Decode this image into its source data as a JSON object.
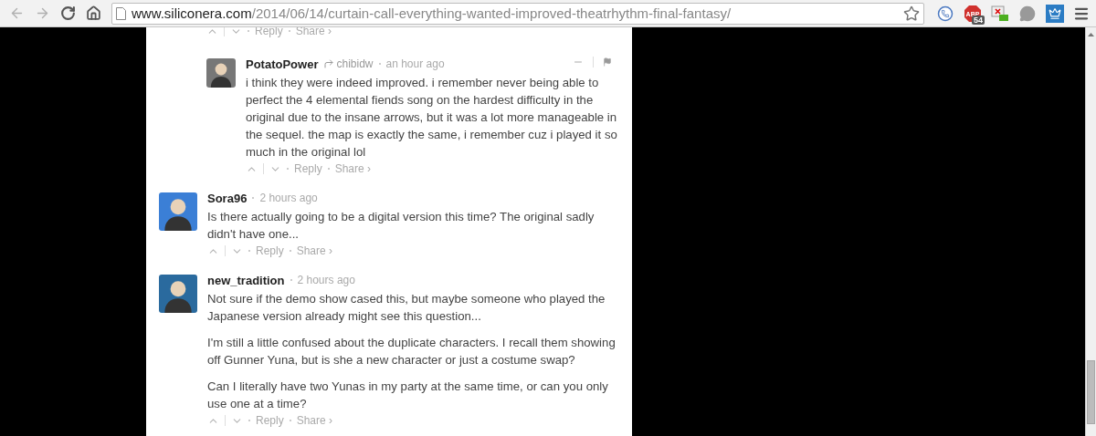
{
  "browser": {
    "url_host": "www.siliconera.com",
    "url_path": "/2014/06/14/curtain-call-everything-wanted-improved-theatrhythm-final-fantasy/",
    "extensions": [
      {
        "kind": "phone"
      },
      {
        "kind": "adblock",
        "label": "ABP",
        "badge": "54"
      },
      {
        "kind": "screen"
      },
      {
        "kind": "bubble"
      },
      {
        "kind": "crown"
      }
    ]
  },
  "previous_actions": {
    "reply": "Reply",
    "share": "Share ›"
  },
  "comments": [
    {
      "kind": "reply",
      "author": "PotatoPower",
      "reply_to": "chibidw",
      "time": "an hour ago",
      "paragraphs": [
        "i think they were indeed improved. i remember never being able to perfect the 4 elemental fiends song on the hardest difficulty in the original due to the insane arrows, but it was a lot more manageable in the sequel. the map is exactly the same, i remember cuz i played it so much in the original lol"
      ],
      "actions": {
        "reply": "Reply",
        "share": "Share ›"
      },
      "hover_controls": true
    },
    {
      "kind": "top",
      "author": "Sora96",
      "time": "2 hours ago",
      "paragraphs": [
        "Is there actually going to be a digital version this time? The original sadly didn't have one..."
      ],
      "actions": {
        "reply": "Reply",
        "share": "Share ›"
      },
      "hover_controls": false
    },
    {
      "kind": "top",
      "author": "new_tradition",
      "time": "2 hours ago",
      "paragraphs": [
        "Not sure if the demo show cased this, but maybe someone who played the Japanese version already might see this question...",
        "I'm still a little confused about the duplicate characters. I recall them showing off Gunner Yuna, but is she a new character or just a costume swap?",
        "Can I literally have two Yunas in my party at the same time, or can you only use one at a time?"
      ],
      "actions": {
        "reply": "Reply",
        "share": "Share ›"
      },
      "hover_controls": false
    }
  ]
}
